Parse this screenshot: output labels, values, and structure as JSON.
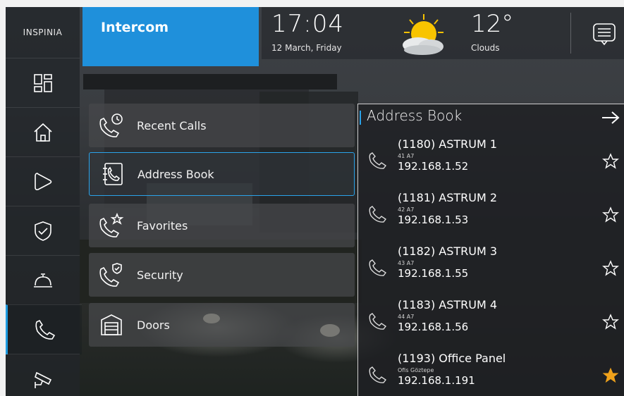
{
  "brand": {
    "logo": "INSPINIA"
  },
  "header": {
    "section_title": "Intercom",
    "time": "17:04",
    "date": "12 March, Friday",
    "temperature": "12°",
    "condition": "Clouds",
    "weather_icon": "sun-cloud-icon",
    "message_icon": "message-icon"
  },
  "sidebar": {
    "items": [
      {
        "icon": "dashboard-icon",
        "active": false
      },
      {
        "icon": "home-icon",
        "active": false
      },
      {
        "icon": "play-icon",
        "active": false
      },
      {
        "icon": "shield-icon",
        "active": false
      },
      {
        "icon": "service-bell-icon",
        "active": false
      },
      {
        "icon": "phone-icon",
        "active": true
      },
      {
        "icon": "camera-icon",
        "active": false
      }
    ]
  },
  "menu": {
    "items": [
      {
        "label": "Recent Calls",
        "icon": "phone-clock-icon",
        "selected": false
      },
      {
        "label": "Address Book",
        "icon": "address-book-icon",
        "selected": true
      },
      {
        "label": "Favorites",
        "icon": "phone-star-icon",
        "selected": false
      },
      {
        "label": "Security",
        "icon": "phone-shield-icon",
        "selected": false
      },
      {
        "label": "Doors",
        "icon": "garage-door-icon",
        "selected": false
      }
    ]
  },
  "address_book": {
    "title": "Address Book",
    "entries": [
      {
        "name": "(1180) ASTRUM 1",
        "sub": "41 A7",
        "ip": "192.168.1.52",
        "favorite": false
      },
      {
        "name": "(1181) ASTRUM 2",
        "sub": "42 A7",
        "ip": "192.168.1.53",
        "favorite": false
      },
      {
        "name": "(1182) ASTRUM 3",
        "sub": "43 A7",
        "ip": "192.168.1.55",
        "favorite": false
      },
      {
        "name": "(1183) ASTRUM 4",
        "sub": "44 A7",
        "ip": "192.168.1.56",
        "favorite": false
      },
      {
        "name": "(1193) Office Panel",
        "sub": "Ofis Göztepe",
        "ip": "192.168.1.191",
        "favorite": true
      }
    ]
  },
  "colors": {
    "accent": "#1f90db",
    "star_active": "#f0a21b"
  }
}
